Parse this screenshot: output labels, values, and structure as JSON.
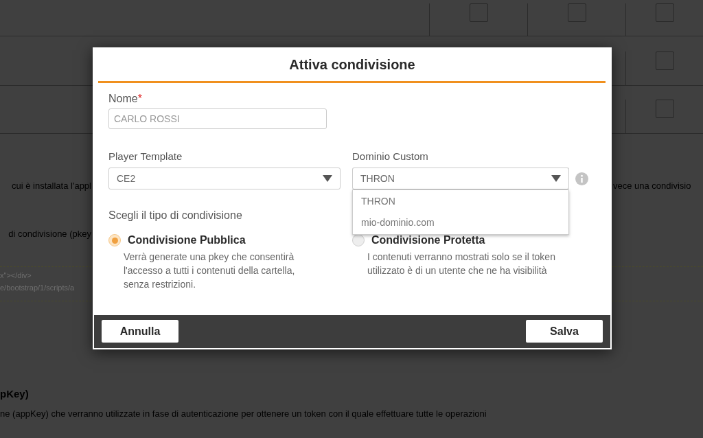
{
  "background": {
    "table": {
      "rows": [
        {
          "checkboxes": [
            {
              "checked": false
            },
            {
              "checked": false
            },
            {
              "checked": false
            }
          ]
        },
        {
          "checkboxes": [
            {
              "checked": false
            }
          ]
        },
        {
          "checkboxes": [
            {
              "checked": false
            }
          ]
        }
      ]
    },
    "text_left": "cui è installata l'appl",
    "text_right": "vece una condivisio",
    "text_pkey": "di condivisione (pkey",
    "code_lines": [
      "x\"></div>",
      "e/bootstrap/1/scripts/a"
    ],
    "heading": "pKey)",
    "paragraph": "ne (appKey) che verranno utilizzate in fase di autenticazione per ottenere un token con il quale effettuare tutte le operazioni"
  },
  "dialog": {
    "title": "Attiva condivisione",
    "name_field": {
      "label": "Nome",
      "required_mark": "*",
      "placeholder": "CARLO ROSSI"
    },
    "player_template": {
      "label": "Player Template",
      "value": "CE2"
    },
    "custom_domain": {
      "label": "Dominio Custom",
      "value": "THRON",
      "expanded": true,
      "options": [
        {
          "label": "THRON"
        },
        {
          "label": "mio-dominio.com"
        }
      ]
    },
    "share_type": {
      "label": "Scegli il tipo di condivisione",
      "options": [
        {
          "label": "Condivisione Pubblica",
          "description": "Verrà generate una pkey che consentirà l'accesso a tutti i contenuti della cartella, senza restrizioni.",
          "selected": true
        },
        {
          "label": "Condivisione Protetta",
          "description": "I contenuti verranno mostrati solo se il token utilizzato è di un utente che ne ha visibilità",
          "selected": false
        }
      ]
    },
    "buttons": [
      {
        "label": "Annulla"
      },
      {
        "label": "Salva"
      }
    ]
  }
}
